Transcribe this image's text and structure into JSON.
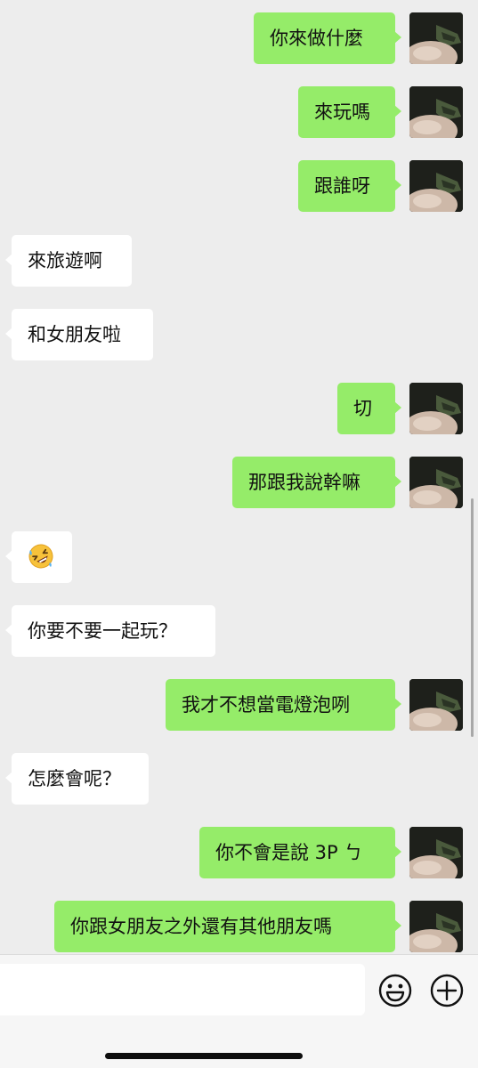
{
  "messages": [
    {
      "side": "out",
      "text": "你來做什麼"
    },
    {
      "side": "out",
      "text": "來玩嗎"
    },
    {
      "side": "out",
      "text": "跟誰呀"
    },
    {
      "side": "in",
      "text": "來旅遊啊"
    },
    {
      "side": "in",
      "text": "和女朋友啦"
    },
    {
      "side": "out",
      "text": "切"
    },
    {
      "side": "out",
      "text": "那跟我說幹嘛"
    },
    {
      "side": "in",
      "text": "",
      "emoji": "rolling-on-the-floor-laughing-emoji"
    },
    {
      "side": "in",
      "text": "你要不要一起玩？"
    },
    {
      "side": "out",
      "text": "我才不想當電燈泡咧"
    },
    {
      "side": "in",
      "text": "怎麼會呢？"
    },
    {
      "side": "out",
      "text": "你不會是說 3P ㄅ"
    },
    {
      "side": "out",
      "text": "你跟女朋友之外還有其他朋友嗎"
    }
  ],
  "composer": {
    "input_value": "",
    "emoji_icon": "smiley-icon",
    "add_icon": "plus-circle-icon"
  },
  "colors": {
    "background": "#ededed",
    "outgoing_bubble": "#95ec69",
    "incoming_bubble": "#ffffff"
  }
}
